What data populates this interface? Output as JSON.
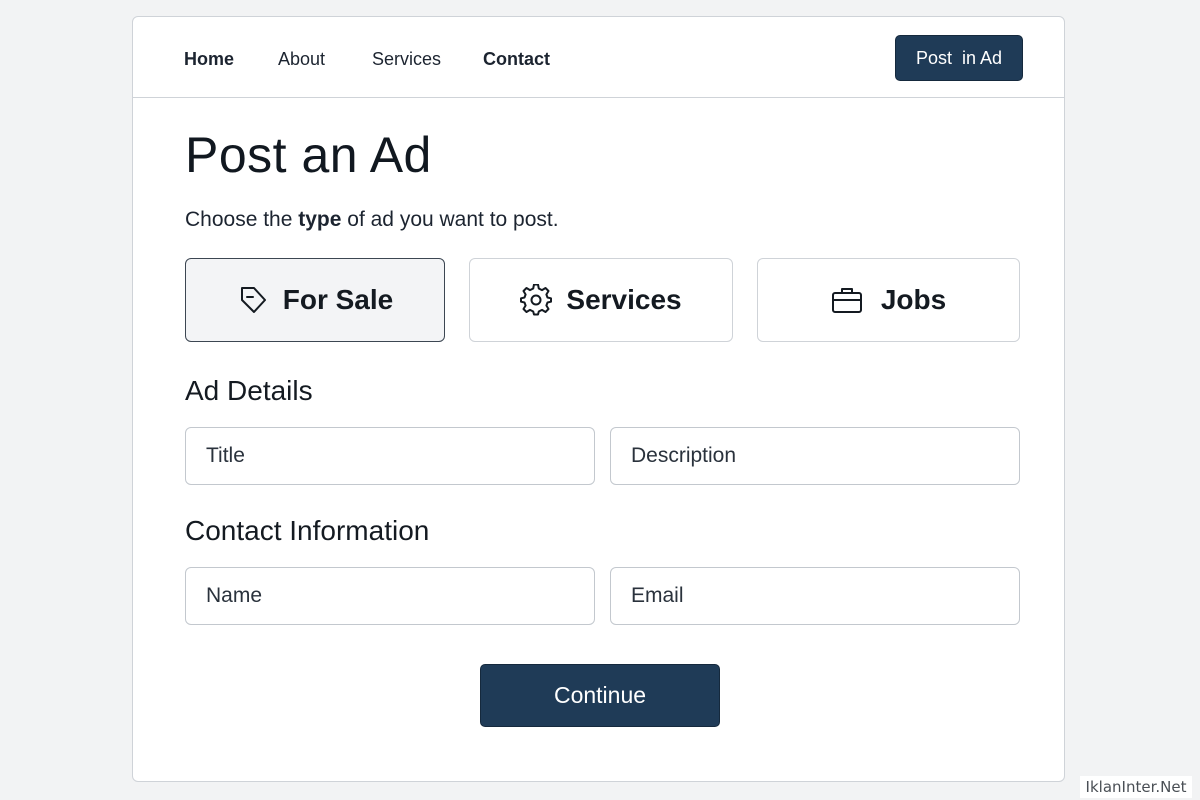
{
  "nav": {
    "links": [
      {
        "label": "Home"
      },
      {
        "label": "About"
      },
      {
        "label": "Services"
      },
      {
        "label": "Contact"
      }
    ],
    "post_button": "Post  in Ad"
  },
  "page": {
    "title": "Post an Ad",
    "subtitle_pre": "Choose the ",
    "subtitle_bold": "type",
    "subtitle_post": " of ad you want to post."
  },
  "ad_types": [
    {
      "label": "For Sale",
      "icon": "tag-icon",
      "selected": true
    },
    {
      "label": "Services",
      "icon": "gear-icon",
      "selected": false
    },
    {
      "label": "Jobs",
      "icon": "briefcase-icon",
      "selected": false
    }
  ],
  "ad_details": {
    "heading": "Ad Details",
    "title_placeholder": "Title",
    "description_placeholder": "Description"
  },
  "contact": {
    "heading": "Contact Information",
    "name_placeholder": "Name",
    "email_placeholder": "Email"
  },
  "continue_label": "Continue",
  "watermark": "IklanInter.Net",
  "colors": {
    "primary": "#1f3b57",
    "background": "#f2f3f4",
    "selected_card": "#f3f4f6"
  }
}
